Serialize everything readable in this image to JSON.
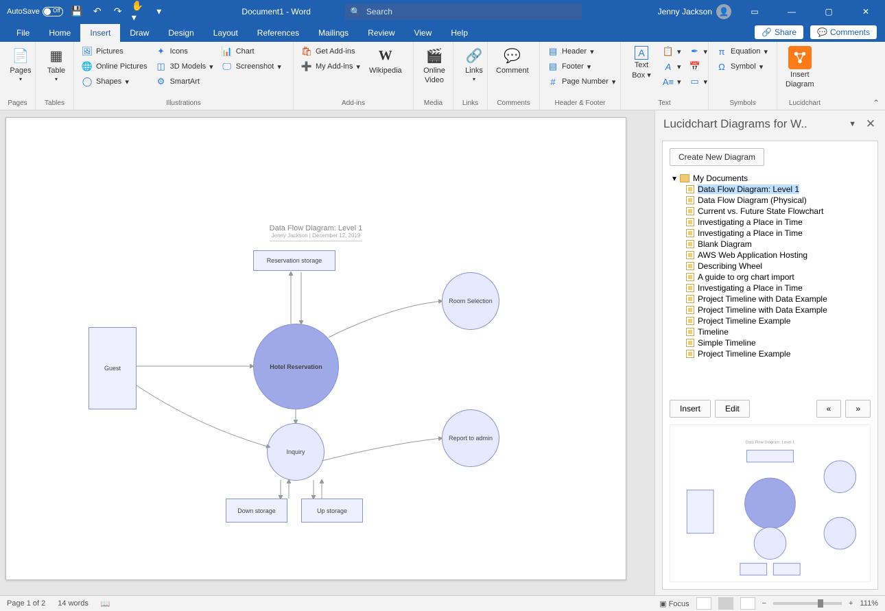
{
  "titlebar": {
    "autosave_label": "AutoSave",
    "autosave_state": "Off",
    "doc_title": "Document1 - Word",
    "search_placeholder": "Search",
    "user_name": "Jenny Jackson"
  },
  "tabs": {
    "file": "File",
    "home": "Home",
    "insert": "Insert",
    "draw": "Draw",
    "design": "Design",
    "layout": "Layout",
    "references": "References",
    "mailings": "Mailings",
    "review": "Review",
    "view": "View",
    "help": "Help",
    "share": "Share",
    "comments": "Comments"
  },
  "ribbon": {
    "pages": {
      "label": "Pages",
      "btn": "Pages"
    },
    "tables": {
      "label": "Tables",
      "btn": "Table"
    },
    "illustrations": {
      "label": "Illustrations",
      "pictures": "Pictures",
      "online_pictures": "Online Pictures",
      "shapes": "Shapes",
      "icons": "Icons",
      "models": "3D Models",
      "smartart": "SmartArt",
      "chart": "Chart",
      "screenshot": "Screenshot"
    },
    "addins": {
      "label": "Add-ins",
      "get": "Get Add-ins",
      "my": "My Add-ins",
      "wikipedia": "Wikipedia"
    },
    "media": {
      "label": "Media",
      "btn_l1": "Online",
      "btn_l2": "Video"
    },
    "links": {
      "label": "Links",
      "btn": "Links"
    },
    "comments": {
      "label": "Comments",
      "btn": "Comment"
    },
    "headerfooter": {
      "label": "Header & Footer",
      "header": "Header",
      "footer": "Footer",
      "page_number": "Page Number"
    },
    "text": {
      "label": "Text",
      "textbox_l1": "Text",
      "textbox_l2": "Box"
    },
    "symbols": {
      "label": "Symbols",
      "equation": "Equation",
      "symbol": "Symbol"
    },
    "lucid": {
      "label": "Lucidchart",
      "btn_l1": "Insert",
      "btn_l2": "Diagram"
    }
  },
  "diagram": {
    "title": "Data Flow Diagram: Level 1",
    "subtitle": "Jenny Jackson  |  December 12, 2019",
    "nodes": {
      "reservation_storage": "Reservation storage",
      "guest": "Guest",
      "hotel_reservation": "Hotel Reservation",
      "room_selection": "Room Selection",
      "inquiry": "Inquiry",
      "report_admin": "Report to admin",
      "down_storage": "Down storage",
      "up_storage": "Up storage"
    }
  },
  "panel": {
    "title": "Lucidchart Diagrams for W..",
    "create": "Create New Diagram",
    "folder": "My Documents",
    "items": [
      "Data Flow Diagram: Level 1",
      "Data Flow Diagram (Physical)",
      "Current vs. Future State Flowchart",
      "Investigating a Place in Time",
      "Investigating a Place in Time",
      "Blank Diagram",
      "AWS Web Application Hosting",
      "Describing Wheel",
      "A guide to org chart import",
      "Investigating a Place in Time",
      "Project Timeline with Data Example",
      "Project Timeline with Data Example",
      "Project Timeline Example",
      "Timeline",
      "Simple Timeline",
      "Project Timeline Example"
    ],
    "insert": "Insert",
    "edit": "Edit",
    "prev": "«",
    "next": "»"
  },
  "status": {
    "page": "Page 1 of 2",
    "words": "14 words",
    "focus": "Focus",
    "zoom": "111%"
  }
}
